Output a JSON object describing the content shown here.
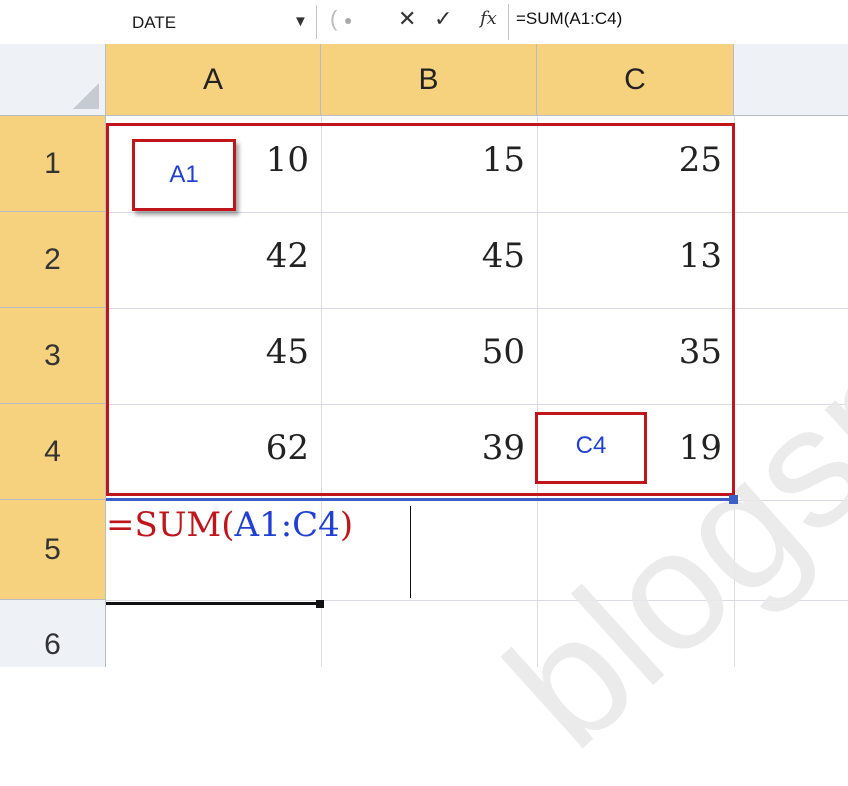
{
  "formula_bar": {
    "name_box": "DATE",
    "cancel_icon": "✕",
    "enter_icon": "✓",
    "fx_label": "fx",
    "formula": "=SUM(A1:C4)"
  },
  "columns": [
    "A",
    "B",
    "C"
  ],
  "rows": [
    "1",
    "2",
    "3",
    "4",
    "5",
    "6"
  ],
  "cells": [
    [
      "10",
      "15",
      "25"
    ],
    [
      "42",
      "45",
      "13"
    ],
    [
      "45",
      "50",
      "35"
    ],
    [
      "62",
      "39",
      "19"
    ]
  ],
  "edit_cell": {
    "prefix": "=SUM(",
    "ref1": "A1",
    "colon": ":",
    "ref2": "C4",
    "suffix": ")"
  },
  "annotations": {
    "start_label": "A1",
    "end_label": "C4"
  },
  "watermark": "blogsp",
  "colors": {
    "range_border": "#c0161b",
    "reference_text": "#1f3fd6",
    "formula_text": "#c0161b",
    "active_header": "#f6d27e"
  }
}
